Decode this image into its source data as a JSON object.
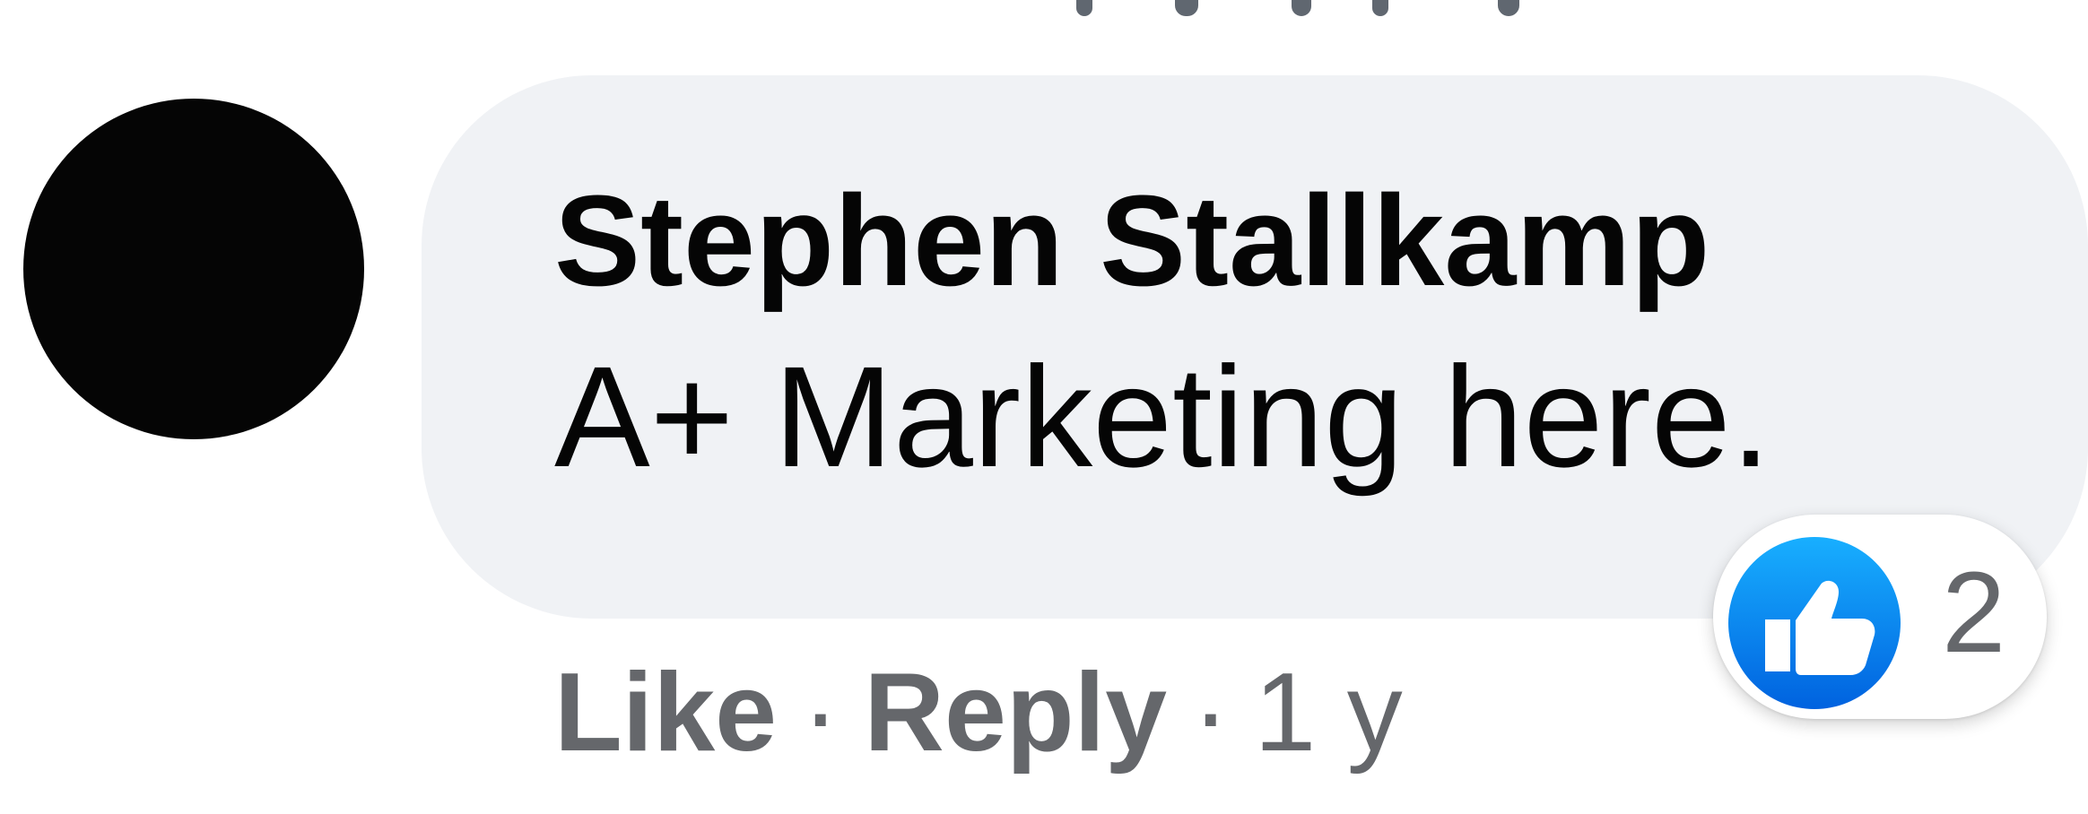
{
  "comment": {
    "author": "Stephen Stallkamp",
    "text": "A+ Marketing here.",
    "actions": {
      "like_label": "Like",
      "reply_label": "Reply",
      "separator": "·",
      "timestamp": "1 y"
    },
    "reactions": {
      "icon": "thumbs-up-icon",
      "count": "2",
      "icon_color": "#1877f2"
    }
  },
  "colors": {
    "bubble_background": "#f0f2f5",
    "primary_text": "#050505",
    "secondary_text": "#65676b",
    "avatar_fill": "#050505"
  }
}
